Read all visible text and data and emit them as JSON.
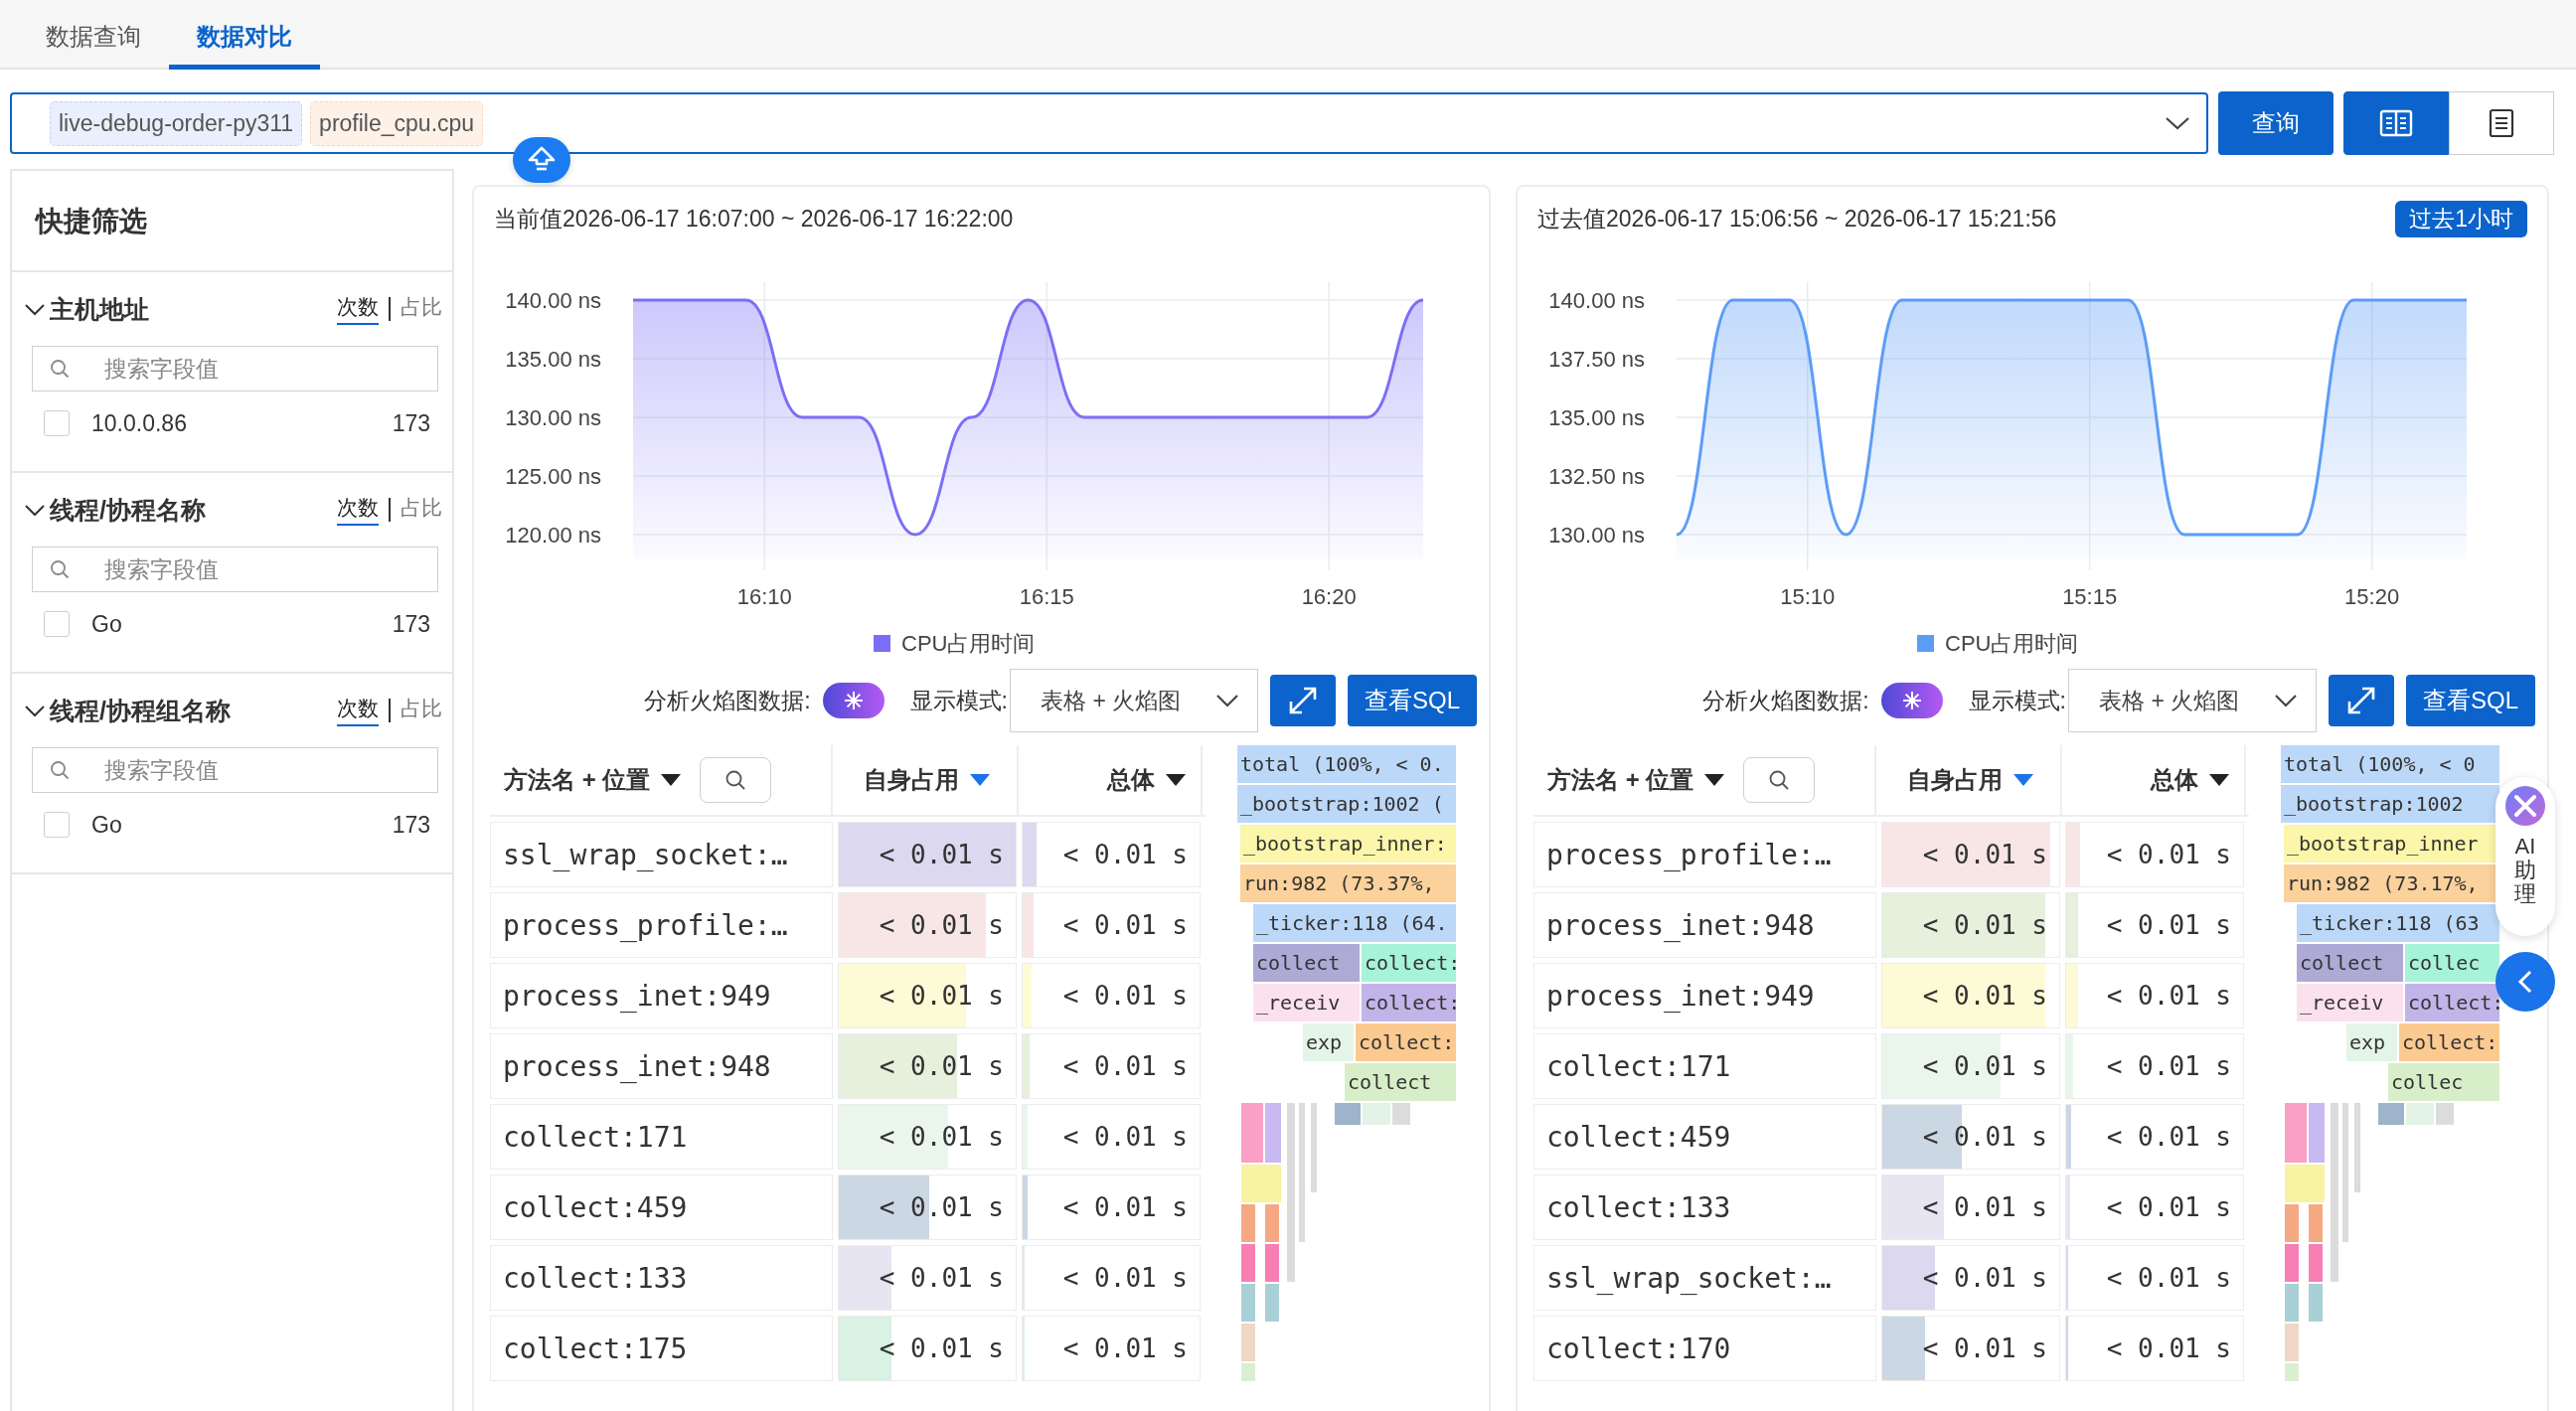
{
  "tabs": [
    {
      "label": "数据查询",
      "selected": false
    },
    {
      "label": "数据对比",
      "selected": true
    }
  ],
  "query": {
    "tags": [
      {
        "text": "live-debug-order-py311",
        "color": "#e9effc"
      },
      {
        "text": "profile_cpu.cpu",
        "color": "#fdf1e8"
      }
    ],
    "search_button": "查询",
    "view_modes": [
      {
        "kind": "columns",
        "selected": true
      },
      {
        "kind": "list",
        "selected": false
      }
    ]
  },
  "sidebar": {
    "title": "快捷筛选",
    "sections": [
      {
        "title": "主机地址",
        "expanded": true,
        "metrics": [
          {
            "label": "次数",
            "selected": true
          },
          {
            "label": "占比",
            "selected": false
          }
        ],
        "placeholder": "搜索字段值",
        "items": [
          {
            "label": "10.0.0.86",
            "count": "173",
            "checked": false
          }
        ]
      },
      {
        "title": "线程/协程名称",
        "expanded": true,
        "metrics": [
          {
            "label": "次数",
            "selected": true
          },
          {
            "label": "占比",
            "selected": false
          }
        ],
        "placeholder": "搜索字段值",
        "items": [
          {
            "label": "Go",
            "count": "173",
            "checked": false
          }
        ]
      },
      {
        "title": "线程/协程组名称",
        "expanded": true,
        "metrics": [
          {
            "label": "次数",
            "selected": true
          },
          {
            "label": "占比",
            "selected": false
          }
        ],
        "placeholder": "搜索字段值",
        "items": [
          {
            "label": "Go",
            "count": "173",
            "checked": false
          }
        ]
      }
    ]
  },
  "panels": [
    {
      "title": "当前值2026-06-17 16:07:00 ~ 2026-06-17 16:22:00",
      "chart_data": {
        "type": "area",
        "grid": true,
        "x": [
          967.67,
          968.67,
          969.67,
          970.67,
          971.67,
          972.67,
          973.67,
          974.67,
          975.67,
          976.67,
          977.67,
          978.67,
          979.67,
          980.67,
          981.67
        ],
        "series": [
          {
            "name": "CPU占用时间",
            "color": "#7b6ef6",
            "values": [
              140,
              140,
              140,
              130,
              130,
              120,
              130,
              140,
              130,
              130,
              130,
              130,
              130,
              130,
              140
            ]
          }
        ],
        "xlim": [
          967.67,
          981.67
        ],
        "ylim": [
          120,
          140
        ],
        "xticks": [
          {
            "value": 970,
            "label": "16:10"
          },
          {
            "value": 975,
            "label": "16:15"
          },
          {
            "value": 980,
            "label": "16:20"
          }
        ],
        "yticks": [
          {
            "value": 140,
            "label": "140.00 ns"
          },
          {
            "value": 135,
            "label": "135.00 ns"
          },
          {
            "value": 130,
            "label": "130.00 ns"
          },
          {
            "value": 125,
            "label": "125.00 ns"
          },
          {
            "value": 120,
            "label": "120.00 ns"
          }
        ]
      },
      "flame_label": "分析火焰图数据:",
      "flame_on": true,
      "mode_label": "显示模式:",
      "mode_value": "表格 + 火焰图",
      "sql_button": "查看SQL",
      "columns": [
        {
          "label": "方法名 + 位置",
          "sorted": false
        },
        {
          "label": "自身占用",
          "sorted": true
        },
        {
          "label": "总体",
          "sorted": false
        }
      ],
      "rows": [
        {
          "name": "ssl_wrap_socket:…",
          "self": {
            "text": "< 0.01 s",
            "level": 1.0
          },
          "total": {
            "text": "< 0.01 s",
            "level": 0.08
          },
          "color": "#dcd8ef"
        },
        {
          "name": "process_profile:…",
          "self": {
            "text": "< 0.01 s",
            "level": 0.83
          },
          "total": {
            "text": "< 0.01 s",
            "level": 0.06
          },
          "color": "#f8e6e6"
        },
        {
          "name": "process_inet:949",
          "self": {
            "text": "< 0.01 s",
            "level": 0.72
          },
          "total": {
            "text": "< 0.01 s",
            "level": 0.05
          },
          "color": "#fdfbd5"
        },
        {
          "name": "process_inet:948",
          "self": {
            "text": "< 0.01 s",
            "level": 0.67
          },
          "total": {
            "text": "< 0.01 s",
            "level": 0.04
          },
          "color": "#e6f0dc"
        },
        {
          "name": "collect:171",
          "self": {
            "text": "< 0.01 s",
            "level": 0.62
          },
          "total": {
            "text": "< 0.01 s",
            "level": 0.03
          },
          "color": "#eaf6ec"
        },
        {
          "name": "collect:459",
          "self": {
            "text": "< 0.01 s",
            "level": 0.51
          },
          "total": {
            "text": "< 0.01 s",
            "level": 0.03
          },
          "color": "#ccd7e4"
        },
        {
          "name": "collect:133",
          "self": {
            "text": "< 0.01 s",
            "level": 0.3
          },
          "total": {
            "text": "< 0.01 s",
            "level": 0.01
          },
          "color": "#e7e5f1"
        },
        {
          "name": "collect:175",
          "self": {
            "text": "< 0.01 s",
            "level": 0.3
          },
          "total": {
            "text": "< 0.01 s",
            "level": 0.01
          },
          "color": "#d9f2e3"
        }
      ],
      "flame": [
        [
          {
            "text": "total (100%, < 0.",
            "color": "#bcd8f8"
          }
        ],
        [
          {
            "text": "_bootstrap:1002 (",
            "color": "#bcd8f8"
          }
        ],
        [
          {
            "text": "_bootstrap_inner:",
            "color": "#fbf6a9"
          }
        ],
        [
          {
            "text": "run:982 (73.37%,",
            "color": "#fbd29c"
          }
        ],
        [
          {
            "text": "_ticker:118 (64.",
            "color": "#bcd8f8"
          }
        ],
        [
          {
            "text": "collect",
            "color": "#aeaad6"
          },
          {
            "text": "collect:",
            "color": "#a7f3da"
          }
        ],
        [
          {
            "text": "_receiv",
            "color": "#fbe1ed"
          },
          {
            "text": "collect:",
            "color": "#c2b4e8"
          }
        ],
        [
          {
            "text": "exp",
            "color": "#e4f5e7"
          },
          {
            "text": "collect:",
            "color": "#fbca90"
          }
        ],
        [
          {
            "text": "collect",
            "color": "#d8eec9"
          }
        ]
      ]
    },
    {
      "title": "过去值2026-06-17 15:06:56 ~ 2026-06-17 15:21:56",
      "badge": "过去1小时",
      "chart_data": {
        "type": "area",
        "grid": true,
        "x": [
          907.68,
          908.68,
          909.68,
          910.68,
          911.68,
          912.68,
          913.68,
          914.68,
          915.68,
          916.68,
          917.68,
          918.68,
          919.68,
          920.68,
          921.68
        ],
        "series": [
          {
            "name": "CPU占用时间",
            "color": "#5c9cf7",
            "values": [
              130,
              140,
              140,
              130,
              140,
              140,
              140,
              140,
              140,
              130,
              130,
              130,
              140,
              140,
              140
            ]
          }
        ],
        "xlim": [
          907.68,
          921.68
        ],
        "ylim": [
          130,
          140
        ],
        "xticks": [
          {
            "value": 910,
            "label": "15:10"
          },
          {
            "value": 915,
            "label": "15:15"
          },
          {
            "value": 920,
            "label": "15:20"
          }
        ],
        "yticks": [
          {
            "value": 140,
            "label": "140.00 ns"
          },
          {
            "value": 137.5,
            "label": "137.50 ns"
          },
          {
            "value": 135,
            "label": "135.00 ns"
          },
          {
            "value": 132.5,
            "label": "132.50 ns"
          },
          {
            "value": 130,
            "label": "130.00 ns"
          }
        ]
      },
      "flame_label": "分析火焰图数据:",
      "flame_on": true,
      "mode_label": "显示模式:",
      "mode_value": "表格 + 火焰图",
      "sql_button": "查看SQL",
      "columns": [
        {
          "label": "方法名 + 位置",
          "sorted": false
        },
        {
          "label": "自身占用",
          "sorted": true
        },
        {
          "label": "总体",
          "sorted": false
        }
      ],
      "rows": [
        {
          "name": "process_profile:…",
          "self": {
            "text": "< 0.01 s",
            "level": 0.95
          },
          "total": {
            "text": "< 0.01 s",
            "level": 0.08
          },
          "color": "#f8e6e6"
        },
        {
          "name": "process_inet:948",
          "self": {
            "text": "< 0.01 s",
            "level": 0.92
          },
          "total": {
            "text": "< 0.01 s",
            "level": 0.07
          },
          "color": "#e6f0dc"
        },
        {
          "name": "process_inet:949",
          "self": {
            "text": "< 0.01 s",
            "level": 0.92
          },
          "total": {
            "text": "< 0.01 s",
            "level": 0.07
          },
          "color": "#fdfbd5"
        },
        {
          "name": "collect:171",
          "self": {
            "text": "< 0.01 s",
            "level": 0.67
          },
          "total": {
            "text": "< 0.01 s",
            "level": 0.04
          },
          "color": "#eaf6ec"
        },
        {
          "name": "collect:459",
          "self": {
            "text": "< 0.01 s",
            "level": 0.45
          },
          "total": {
            "text": "< 0.01 s",
            "level": 0.03
          },
          "color": "#ccd7e4"
        },
        {
          "name": "collect:133",
          "self": {
            "text": "< 0.01 s",
            "level": 0.35
          },
          "total": {
            "text": "< 0.01 s",
            "level": 0.02
          },
          "color": "#e7e5f1"
        },
        {
          "name": "ssl_wrap_socket:…",
          "self": {
            "text": "< 0.01 s",
            "level": 0.3
          },
          "total": {
            "text": "< 0.01 s",
            "level": 0.01
          },
          "color": "#dcd8ef"
        },
        {
          "name": "collect:170",
          "self": {
            "text": "< 0.01 s",
            "level": 0.24
          },
          "total": {
            "text": "< 0.01 s",
            "level": 0.01
          },
          "color": "#ccd7e4"
        }
      ],
      "flame": [
        [
          {
            "text": "total (100%, < 0",
            "color": "#bcd8f8"
          }
        ],
        [
          {
            "text": "_bootstrap:1002",
            "color": "#bcd8f8"
          }
        ],
        [
          {
            "text": "_bootstrap_inner",
            "color": "#fbf6a9"
          }
        ],
        [
          {
            "text": "run:982 (73.17%,",
            "color": "#fbd29c"
          }
        ],
        [
          {
            "text": "_ticker:118 (63",
            "color": "#bcd8f8"
          }
        ],
        [
          {
            "text": "collect",
            "color": "#aeaad6"
          },
          {
            "text": "collec",
            "color": "#a7f3da"
          }
        ],
        [
          {
            "text": "_receiv",
            "color": "#fbe1ed"
          },
          {
            "text": "collect:",
            "color": "#c2b4e8"
          }
        ],
        [
          {
            "text": "exp",
            "color": "#e4f5e7"
          },
          {
            "text": "collect:",
            "color": "#fbca90"
          }
        ],
        [
          {
            "text": "collec",
            "color": "#d8eec9"
          }
        ]
      ]
    }
  ],
  "assistant": {
    "label": "AI助理"
  }
}
